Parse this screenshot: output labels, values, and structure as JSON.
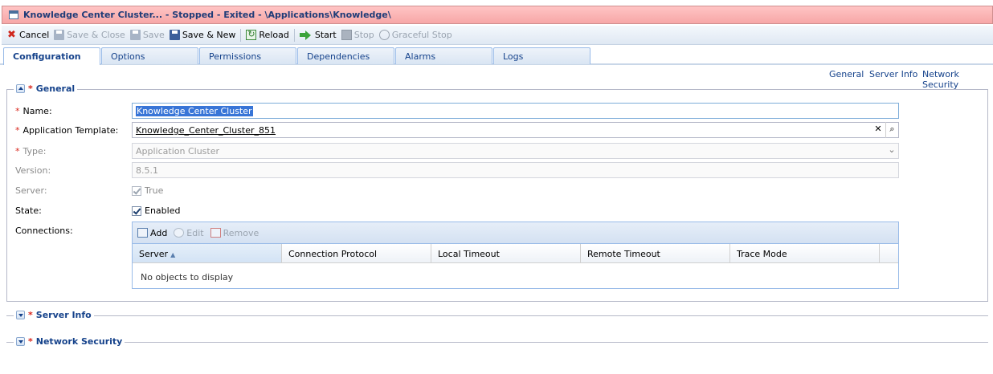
{
  "window": {
    "title": "Knowledge Center Cluster... - Stopped - Exited - \\Applications\\Knowledge\\"
  },
  "toolbar": {
    "cancel": "Cancel",
    "save_close": "Save & Close",
    "save": "Save",
    "save_new": "Save & New",
    "reload": "Reload",
    "start": "Start",
    "stop": "Stop",
    "graceful_stop": "Graceful Stop"
  },
  "tabs": [
    "Configuration",
    "Options",
    "Permissions",
    "Dependencies",
    "Alarms",
    "Logs"
  ],
  "quick_links": [
    "General",
    "Server Info",
    "Network Security"
  ],
  "sections": {
    "general": "General",
    "server_info": "Server Info",
    "network_security": "Network Security"
  },
  "form": {
    "name_label": "Name:",
    "name_value": "Knowledge Center Cluster",
    "template_label": "Application Template:",
    "template_value": "Knowledge_Center_Cluster_851",
    "type_label": "Type:",
    "type_value": "Application Cluster",
    "version_label": "Version:",
    "version_value": "8.5.1",
    "server_label": "Server:",
    "server_value": "True",
    "state_label": "State:",
    "state_value": "Enabled",
    "connections_label": "Connections:"
  },
  "connections": {
    "add": "Add",
    "edit": "Edit",
    "remove": "Remove",
    "columns": [
      "Server",
      "Connection Protocol",
      "Local Timeout",
      "Remote Timeout",
      "Trace Mode"
    ],
    "empty": "No objects to display"
  },
  "required_mark": "*"
}
